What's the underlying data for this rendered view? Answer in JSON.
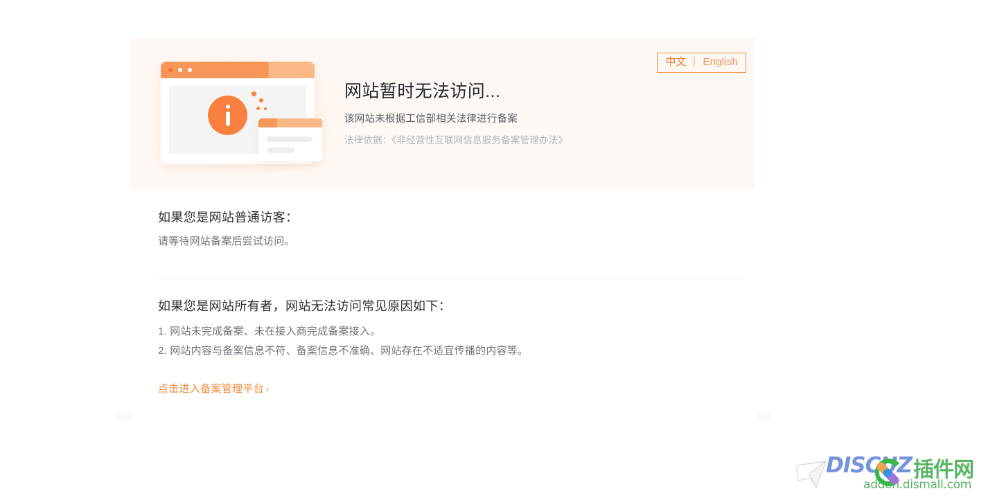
{
  "hero": {
    "lang_switch": {
      "chinese_label": "中文",
      "separator": "丨",
      "english_label": "English"
    },
    "title": "网站暂时无法访问...",
    "subtitle": "该网站未根据工信部相关法律进行备案",
    "legal_basis": "法律依据：《非经营性互联网信息服务备案管理办法》",
    "illustration": {
      "name": "browser-window-info-illustration",
      "browser_bar_color": "#f79659",
      "info_badge_color": "#f9803e",
      "card_background": "#fef8f4"
    }
  },
  "visitor_section": {
    "heading": "如果您是网站普通访客：",
    "paragraph": "请等待网站备案后尝试访问。"
  },
  "owner_section": {
    "heading": "如果您是网站所有者，网站无法访问常见原因如下：",
    "reasons": [
      "1. 网站未完成备案、未在接入商完成备案接入。",
      "2. 网站内容与备案信息不符、备案信息不准确、网站存在不适宜传播的内容等。"
    ]
  },
  "cta": {
    "label": "点击进入备案管理平台",
    "chevron": "›",
    "color": "#f5883a"
  },
  "watermark": {
    "brand": "DISCUZ",
    "brand_cn": "插件网",
    "url": "addon.dismall.com",
    "brand_color": "#5a7fd6",
    "accent_color": "#3fa94c"
  }
}
